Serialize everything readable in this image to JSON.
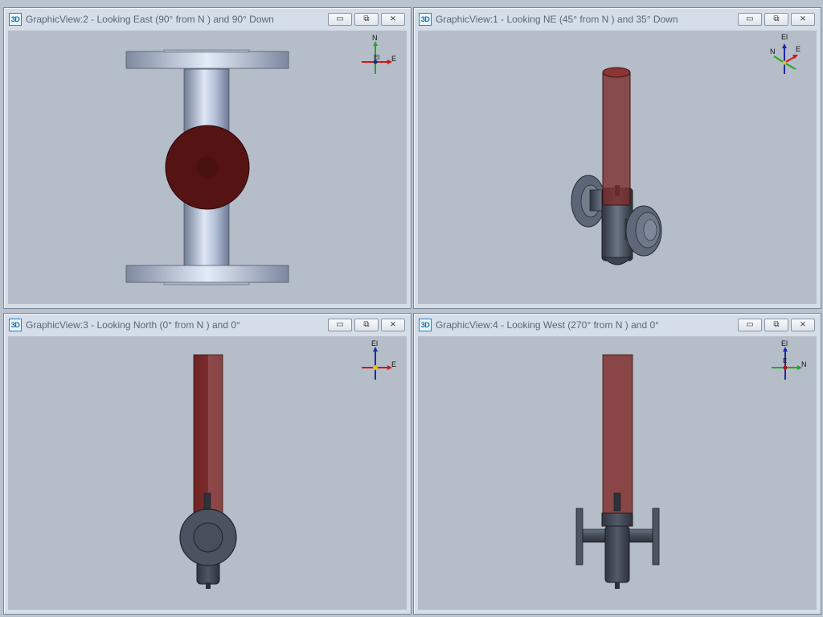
{
  "app_icon_label": "3D",
  "window_buttons": {
    "minimize": "▭",
    "restore": "⧉",
    "close": "⨯"
  },
  "views": [
    {
      "title": "GraphicView:2 - Looking East (90° from N ) and 90° Down",
      "axes": {
        "up": "N",
        "right": "E",
        "center": "El"
      }
    },
    {
      "title": "GraphicView:1 - Looking NE (45° from N ) and 35° Down",
      "axes": {
        "up": "El",
        "right": "E",
        "left": "N"
      }
    },
    {
      "title": "GraphicView:3 - Looking North (0° from N ) and 0°",
      "axes": {
        "up": "El",
        "right": "E"
      }
    },
    {
      "title": "GraphicView:4 - Looking West (270° from N ) and 0°",
      "axes": {
        "up": "El",
        "right": "N",
        "center": "E"
      }
    }
  ]
}
